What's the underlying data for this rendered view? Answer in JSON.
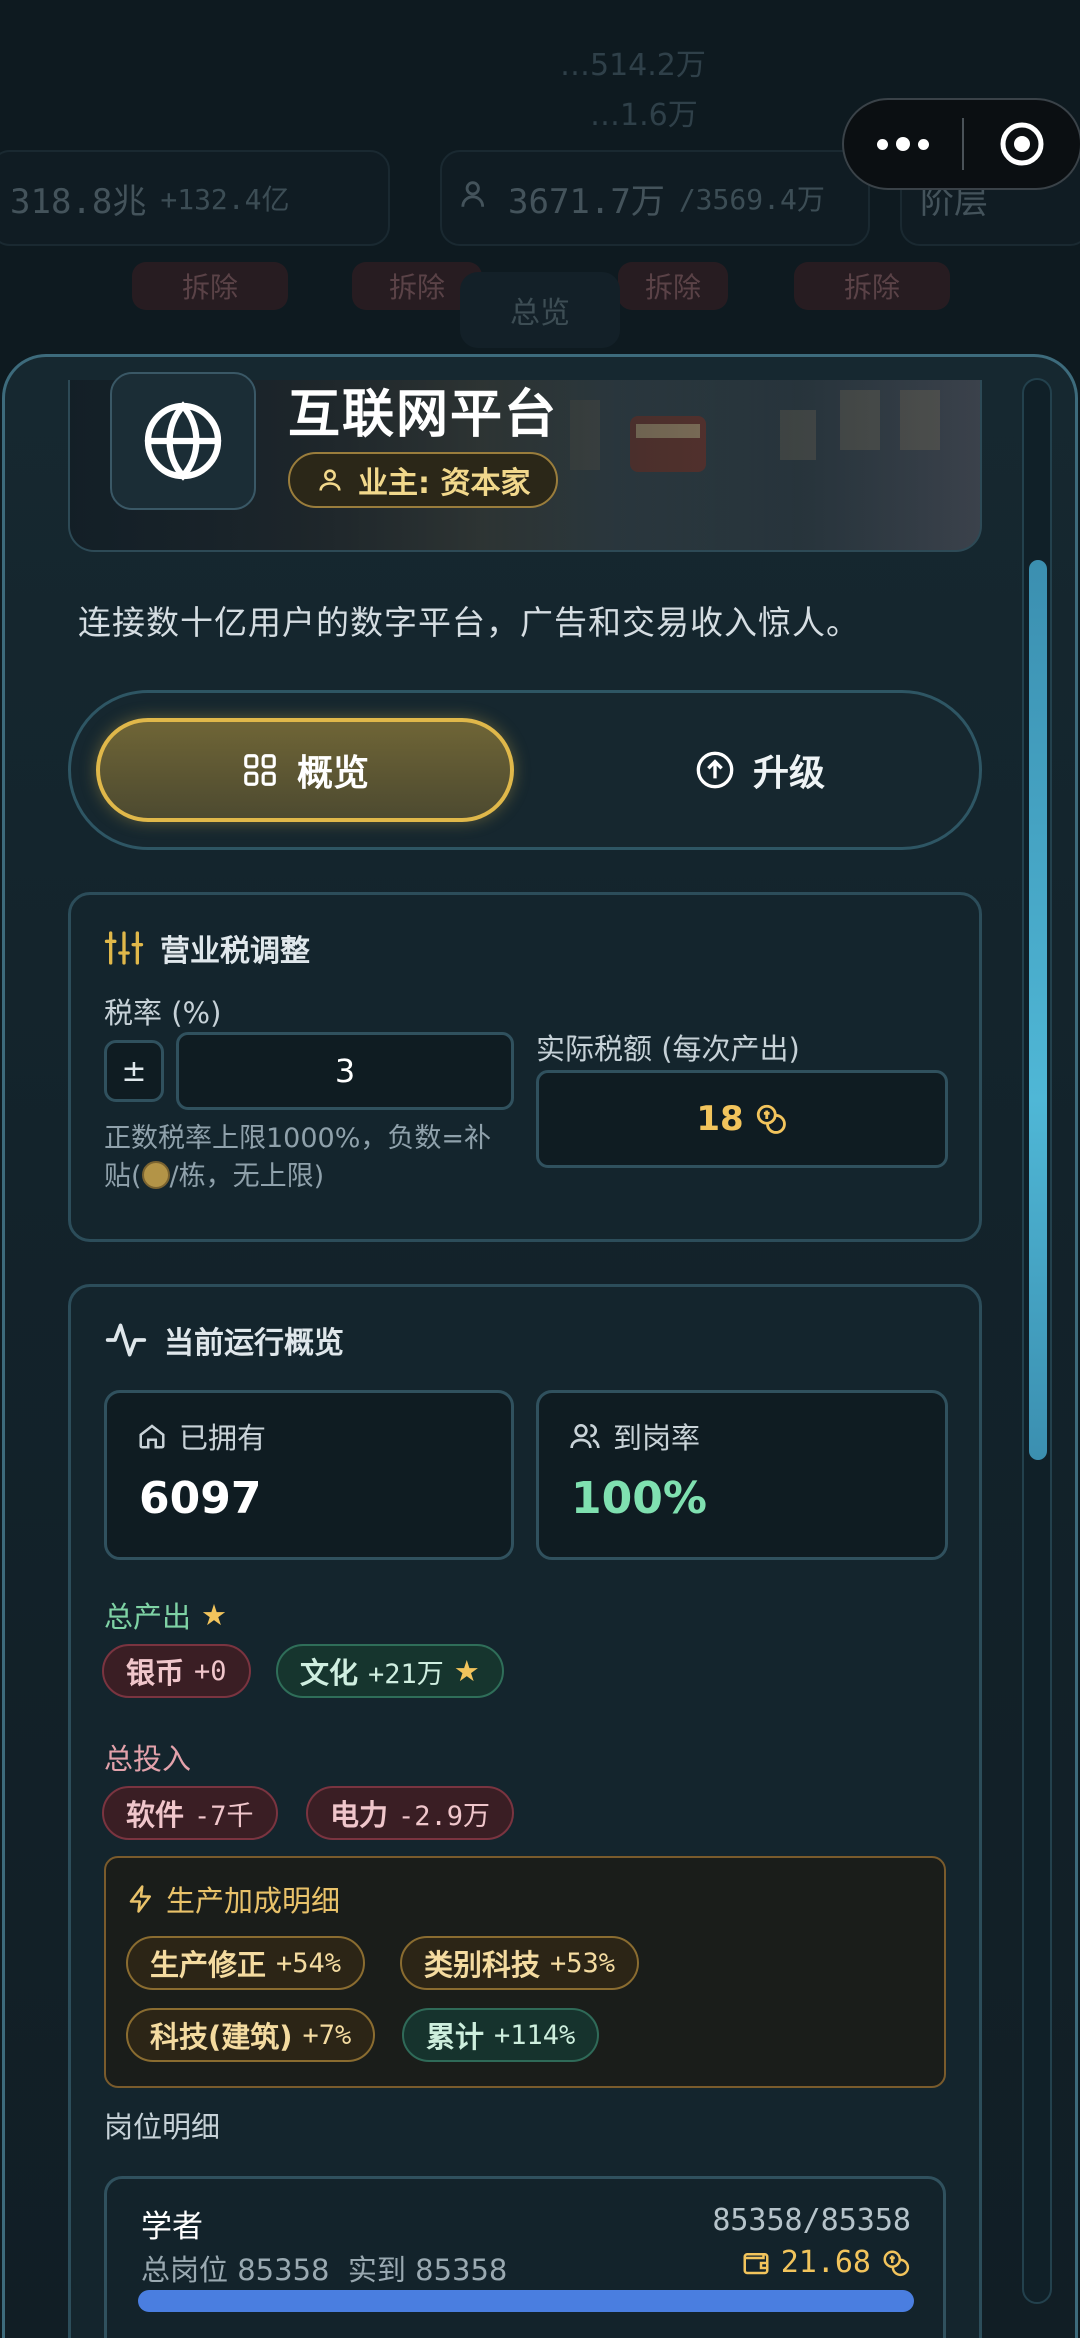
{
  "background": {
    "ghost_top_1": "…514.2万",
    "ghost_top_2": "…1.6万",
    "stat_money": "318.8兆",
    "stat_money_delta": "+132.4亿",
    "stat_pop": "3671.7万",
    "stat_pop_cap": "/3569.4万",
    "stat_floor": "阶层",
    "demolish_label": "拆除",
    "overview_tab": "总览"
  },
  "building": {
    "name": "互联网平台",
    "owner": "业主: 资本家",
    "description": "连接数十亿用户的数字平台，广告和交易收入惊人。"
  },
  "tabs": {
    "overview": "概览",
    "upgrade": "升级",
    "active": "overview"
  },
  "tax": {
    "title": "营业税调整",
    "rate_label": "税率 (%)",
    "sign_button": "±",
    "rate_value": "3",
    "hint_line1": "正数税率上限1000%，负数=补",
    "hint_line2_pre": "贴(",
    "hint_line2_post": "/栋，无上限)",
    "actual_label": "实际税额 (每次产出)",
    "actual_value": "18"
  },
  "overview": {
    "title": "当前运行概览",
    "owned_label": "已拥有",
    "owned_value": "6097",
    "attendance_label": "到岗率",
    "attendance_value": "100%",
    "output_label": "总产出",
    "outputs": [
      {
        "name": "银币",
        "value": "+0"
      },
      {
        "name": "文化",
        "value": "+21万"
      }
    ],
    "input_label": "总投入",
    "inputs": [
      {
        "name": "软件",
        "value": "-7千"
      },
      {
        "name": "电力",
        "value": "-2.9万"
      }
    ],
    "bonus_title": "生产加成明细",
    "bonuses": [
      {
        "name": "生产修正",
        "value": "+54%"
      },
      {
        "name": "类别科技",
        "value": "+53%"
      },
      {
        "name": "科技(建筑)",
        "value": "+7%"
      },
      {
        "name": "累计",
        "value": "+114%"
      }
    ],
    "jobs_label": "岗位明细",
    "job": {
      "name": "学者",
      "ratio": "85358/85358",
      "detail": "总岗位 85358  实到 85358",
      "wage": "21.68",
      "fill_fraction": 1.0
    }
  },
  "colors": {
    "gold_accent": "#e0b84a",
    "attendance_green": "#7fe0b0",
    "scrollbar": "#4fb7d6"
  }
}
